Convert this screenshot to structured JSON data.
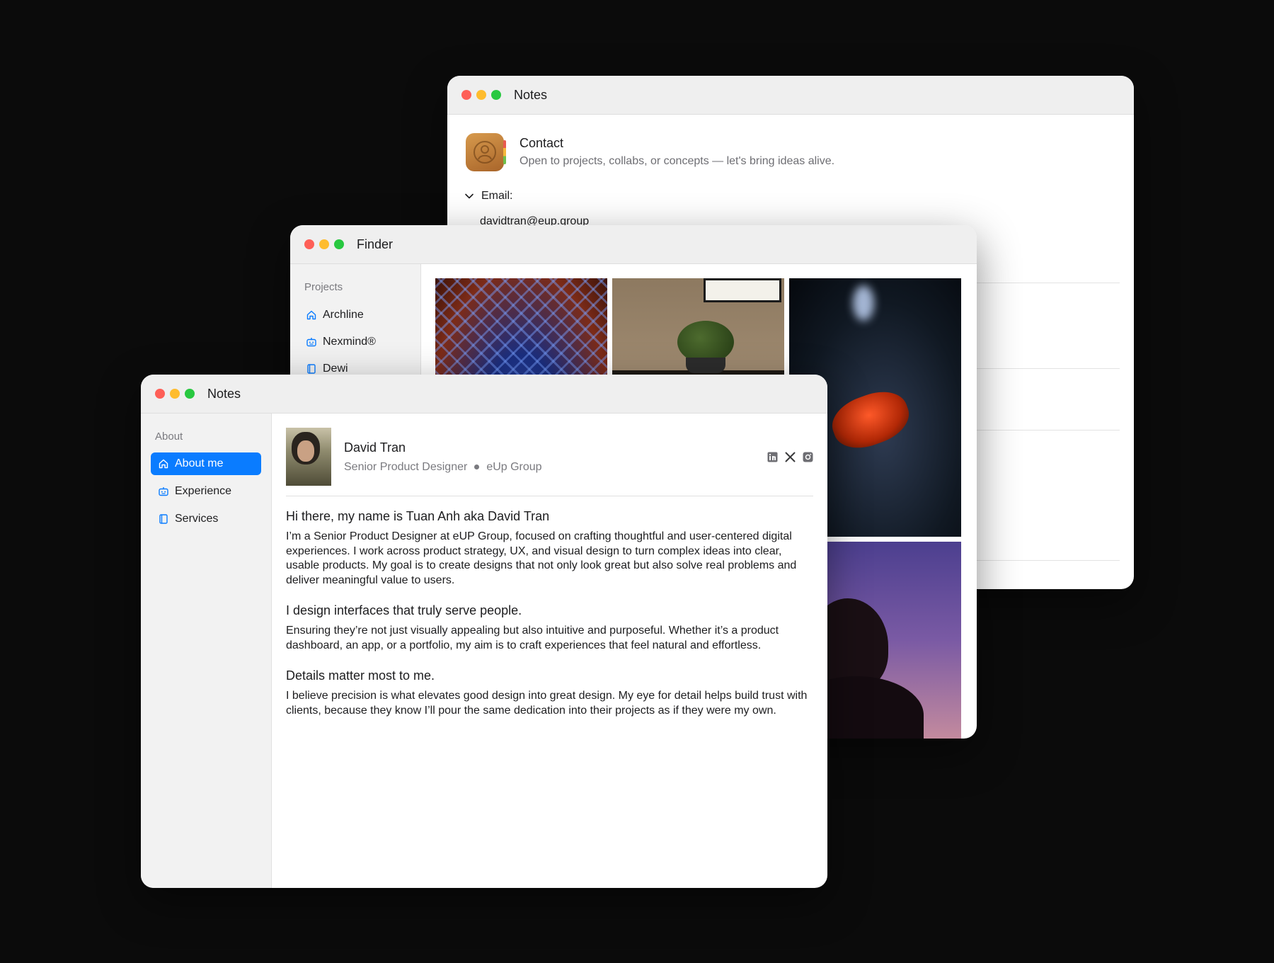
{
  "contact_window": {
    "title": "Notes",
    "heading": "Contact",
    "subtitle": "Open to projects, collabs, or concepts — let's bring ideas alive.",
    "email_label": "Email:",
    "email_value": "davidtran@eup.group"
  },
  "finder_window": {
    "title": "Finder",
    "section": "Projects",
    "items": [
      {
        "label": "Archline",
        "icon": "home-icon"
      },
      {
        "label": "Nexmind®",
        "icon": "bot-icon"
      },
      {
        "label": "Dewi",
        "icon": "book-icon"
      }
    ]
  },
  "about_window": {
    "title": "Notes",
    "section": "About",
    "items": [
      {
        "label": "About me",
        "icon": "home-icon",
        "active": true
      },
      {
        "label": "Experience",
        "icon": "bot-icon",
        "active": false
      },
      {
        "label": "Services",
        "icon": "book-icon",
        "active": false
      }
    ],
    "profile": {
      "name": "David Tran",
      "role": "Senior Product Designer",
      "company": "eUp Group",
      "socials": [
        "linkedin-icon",
        "x-icon",
        "instagram-icon"
      ]
    },
    "sections": [
      {
        "heading": "Hi there, my name is Tuan Anh aka David Tran",
        "body": "I’m a Senior Product Designer at eUP Group, focused on crafting thoughtful and user-centered digital experiences. I work across product strategy, UX, and visual design to turn complex ideas into clear, usable products. My goal is to create designs that not only look great but also solve real problems and deliver meaningful value to users."
      },
      {
        "heading": "I design interfaces that truly serve people.",
        "body": "Ensuring they’re not just visually appealing but also intuitive and purposeful. Whether it’s a product dashboard, an app, or a portfolio, my aim is to craft experiences that feel natural and effortless."
      },
      {
        "heading": "Details matter most to me.",
        "body": "I believe precision is what elevates good design into great design. My eye for detail helps build trust with clients, because they know I’ll pour the same dedication into their projects as if they were my own."
      }
    ]
  },
  "colors": {
    "accent": "#0a7cff",
    "background": "#0b0b0b",
    "close": "#fe5f57",
    "minimize": "#febc2e",
    "zoom": "#28c840"
  }
}
